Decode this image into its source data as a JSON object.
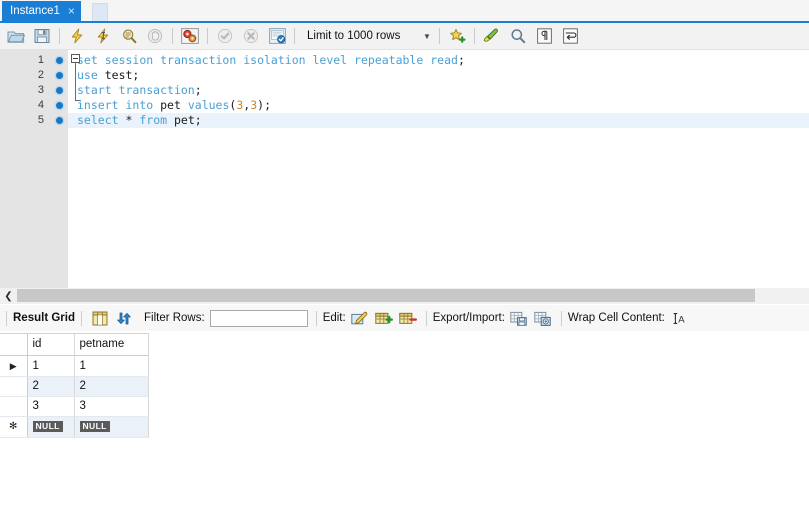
{
  "window": {
    "tabs": [
      {
        "label": "Instance1",
        "close": "×",
        "active": true
      }
    ]
  },
  "toolbar": {
    "buttons": [
      {
        "name": "open-sql-script",
        "title": "Open a script file in this editor"
      },
      {
        "name": "save-script",
        "title": "Save the script to a file"
      },
      {
        "name": "execute-statement",
        "title": "Execute the selected portion of the script"
      },
      {
        "name": "execute-current-statement",
        "title": "Execute the statement under the keyboard cursor"
      },
      {
        "name": "explain-statement",
        "title": "Execute the EXPLAIN command on the statement under the cursor"
      },
      {
        "name": "stop-execution",
        "title": "Stop the query being executed"
      },
      {
        "name": "toggle-transaction",
        "title": "Toggle whether execution should stop or continue"
      },
      {
        "name": "commit-transaction",
        "title": "Commit the current transaction"
      },
      {
        "name": "rollback-transaction",
        "title": "Rollback the current transaction"
      },
      {
        "name": "autocommit-toggle",
        "title": "Toggle autocommit mode"
      }
    ],
    "limit_label": "Limit to 1000 rows",
    "limit_arrow": "▼",
    "right_buttons": [
      {
        "name": "snippets",
        "title": "Save current statement to snippets list"
      },
      {
        "name": "beautify-query",
        "title": "Beautify/reformat the SQL script"
      },
      {
        "name": "find",
        "title": "Show the Find panel for the editor"
      },
      {
        "name": "toggle-invisible-chars",
        "title": "Toggle display of invisible characters"
      },
      {
        "name": "toggle-word-wrap",
        "title": "Toggle wrapping of long lines"
      }
    ]
  },
  "editor": {
    "lines": [
      {
        "number": "1",
        "bookmark": true,
        "current": false,
        "tokens": [
          {
            "t": "set",
            "c": "kw"
          },
          {
            "t": " ",
            "c": "id"
          },
          {
            "t": "session",
            "c": "kw"
          },
          {
            "t": " ",
            "c": "id"
          },
          {
            "t": "transaction",
            "c": "kw"
          },
          {
            "t": " ",
            "c": "id"
          },
          {
            "t": "isolation",
            "c": "kw"
          },
          {
            "t": " ",
            "c": "id"
          },
          {
            "t": "level",
            "c": "kw"
          },
          {
            "t": " ",
            "c": "id"
          },
          {
            "t": "repeatable",
            "c": "kw"
          },
          {
            "t": " ",
            "c": "id"
          },
          {
            "t": "read",
            "c": "kw"
          },
          {
            "t": ";",
            "c": "punc"
          }
        ]
      },
      {
        "number": "2",
        "bookmark": true,
        "current": false,
        "tokens": [
          {
            "t": "use",
            "c": "kw"
          },
          {
            "t": " ",
            "c": "id"
          },
          {
            "t": "test",
            "c": "id"
          },
          {
            "t": ";",
            "c": "punc"
          }
        ]
      },
      {
        "number": "3",
        "bookmark": true,
        "current": false,
        "tokens": [
          {
            "t": "start",
            "c": "kw"
          },
          {
            "t": " ",
            "c": "id"
          },
          {
            "t": "transaction",
            "c": "kw"
          },
          {
            "t": ";",
            "c": "punc"
          }
        ]
      },
      {
        "number": "4",
        "bookmark": true,
        "current": false,
        "tokens": [
          {
            "t": "insert",
            "c": "kw"
          },
          {
            "t": " ",
            "c": "id"
          },
          {
            "t": "into",
            "c": "kw"
          },
          {
            "t": " ",
            "c": "id"
          },
          {
            "t": "pet",
            "c": "id"
          },
          {
            "t": " ",
            "c": "id"
          },
          {
            "t": "values",
            "c": "kw"
          },
          {
            "t": "(",
            "c": "punc"
          },
          {
            "t": "3",
            "c": "num"
          },
          {
            "t": ",",
            "c": "punc"
          },
          {
            "t": "3",
            "c": "num"
          },
          {
            "t": ")",
            "c": "punc"
          },
          {
            "t": ";",
            "c": "punc"
          }
        ]
      },
      {
        "number": "5",
        "bookmark": true,
        "current": true,
        "tokens": [
          {
            "t": "select",
            "c": "kw"
          },
          {
            "t": " ",
            "c": "id"
          },
          {
            "t": "*",
            "c": "op"
          },
          {
            "t": " ",
            "c": "id"
          },
          {
            "t": "from",
            "c": "kw"
          },
          {
            "t": " ",
            "c": "id"
          },
          {
            "t": "pet",
            "c": "id"
          },
          {
            "t": ";",
            "c": "punc"
          }
        ]
      }
    ]
  },
  "scrollbar": {
    "left_arrow": "❮"
  },
  "result_toolbar": {
    "grid_label": "Result Grid",
    "grid_view_icon": "grid-view-icon",
    "refresh_icon": "refresh-icon",
    "filter_label": "Filter Rows:",
    "filter_value": "",
    "filter_placeholder": "",
    "edit_label": "Edit:",
    "edit_buttons": [
      {
        "name": "edit-cell-button"
      },
      {
        "name": "insert-row-button"
      },
      {
        "name": "delete-row-button"
      }
    ],
    "export_label": "Export/Import:",
    "export_buttons": [
      {
        "name": "export-recordset-button"
      },
      {
        "name": "import-recordset-button"
      }
    ],
    "wrap_label": "Wrap Cell Content:",
    "wrap_icon_text": "A"
  },
  "result_grid": {
    "columns": [
      "id",
      "petname"
    ],
    "rows": [
      {
        "marker": "▶",
        "cells": [
          "1",
          "1"
        ],
        "alt": false,
        "null": false
      },
      {
        "marker": "",
        "cells": [
          "2",
          "2"
        ],
        "alt": true,
        "null": false
      },
      {
        "marker": "",
        "cells": [
          "3",
          "3"
        ],
        "alt": false,
        "null": false
      },
      {
        "marker": "✻",
        "cells": [
          "NULL",
          "NULL"
        ],
        "alt": true,
        "null": true
      }
    ],
    "null_text": "NULL"
  },
  "colors": {
    "accent_blue": "#1a7fd4",
    "keyword_blue": "#4a9fd4",
    "number_orange": "#c8892a",
    "selected_row": "#eaf1f9",
    "gutter_gray": "#e4e4e4",
    "null_badge": "#5b5b5b"
  }
}
